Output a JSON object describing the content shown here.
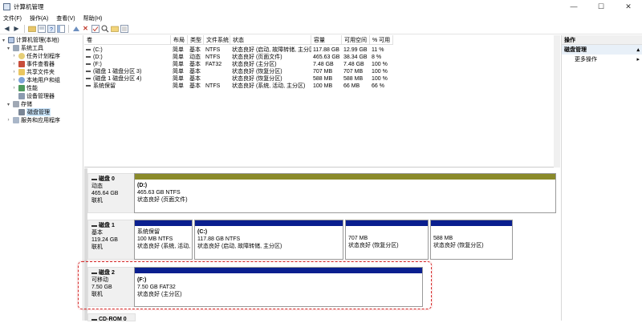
{
  "window": {
    "title": "计算机管理",
    "minimize": "—",
    "maximize": "☐",
    "close": "✕"
  },
  "menu": [
    "文件(F)",
    "操作(A)",
    "查看(V)",
    "帮助(H)"
  ],
  "tree": {
    "root": "计算机管理(本地)",
    "system_tools": "系统工具",
    "task_scheduler": "任务计划程序",
    "event_viewer": "事件查看器",
    "shared_folders": "共享文件夹",
    "local_users": "本地用户和组",
    "performance": "性能",
    "device_manager": "设备管理器",
    "storage": "存储",
    "disk_management": "磁盘管理",
    "services": "服务和应用程序"
  },
  "volume_table": {
    "headers": [
      "卷",
      "布局",
      "类型",
      "文件系统",
      "状态",
      "容量",
      "可用空间",
      "% 可用"
    ],
    "rows": [
      [
        "(C:)",
        "简单",
        "基本",
        "NTFS",
        "状态良好 (启动, 故障转储, 主分区)",
        "117.88 GB",
        "12.99 GB",
        "11 %"
      ],
      [
        "(D:)",
        "简单",
        "动态",
        "NTFS",
        "状态良好 (页面文件)",
        "465.63 GB",
        "38.34 GB",
        "8 %"
      ],
      [
        "(F:)",
        "简单",
        "基本",
        "FAT32",
        "状态良好 (主分区)",
        "7.48 GB",
        "7.48 GB",
        "100 %"
      ],
      [
        "(磁盘 1 磁盘分区 3)",
        "简单",
        "基本",
        "",
        "状态良好 (恢复分区)",
        "707 MB",
        "707 MB",
        "100 %"
      ],
      [
        "(磁盘 1 磁盘分区 4)",
        "简单",
        "基本",
        "",
        "状态良好 (恢复分区)",
        "588 MB",
        "588 MB",
        "100 %"
      ],
      [
        "系统保留",
        "简单",
        "基本",
        "NTFS",
        "状态良好 (系统, 活动, 主分区)",
        "100 MB",
        "66 MB",
        "66 %"
      ]
    ]
  },
  "disks": {
    "disk0": {
      "name": "磁盘 0",
      "type": "动态",
      "size": "465.64 GB",
      "status": "联机",
      "p1": {
        "name": "(D:)",
        "size": "465.63 GB NTFS",
        "status": "状态良好 (页面文件)"
      }
    },
    "disk1": {
      "name": "磁盘 1",
      "type": "基本",
      "size": "119.24 GB",
      "status": "联机",
      "p1": {
        "name": "系统保留",
        "size": "100 MB NTFS",
        "status": "状态良好 (系统, 活动, 主"
      },
      "p2": {
        "name": "(C:)",
        "size": "117.88 GB NTFS",
        "status": "状态良好 (启动, 故障转储, 主分区)"
      },
      "p3": {
        "size": "707 MB",
        "status": "状态良好 (恢复分区)"
      },
      "p4": {
        "size": "588 MB",
        "status": "状态良好 (恢复分区)"
      }
    },
    "disk2": {
      "name": "磁盘 2",
      "type": "可移动",
      "size": "7.50 GB",
      "status": "联机",
      "p1": {
        "name": "(F:)",
        "size": "7.50 GB FAT32",
        "status": "状态良好 (主分区)"
      }
    },
    "cdrom": {
      "name": "CD-ROM 0"
    }
  },
  "actions": {
    "header": "操作",
    "section": "磁盘管理",
    "more": "更多操作"
  },
  "colors": {
    "dynamic_bar": "#8a8a2a",
    "basic_bar": "#0a1f8f",
    "highlight": "#d52a2a"
  }
}
